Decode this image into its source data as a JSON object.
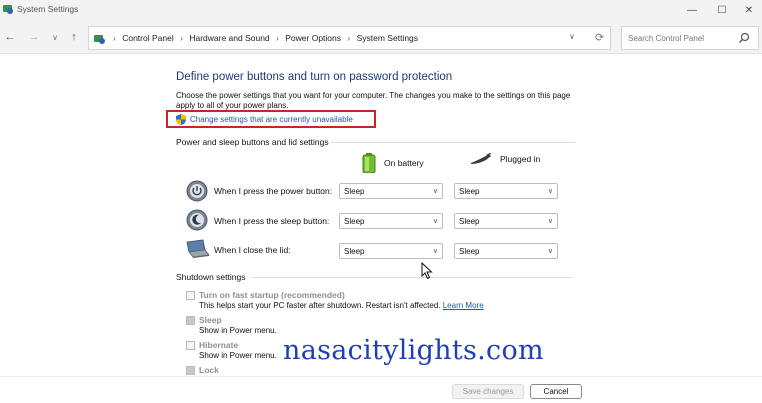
{
  "window": {
    "title": "System Settings",
    "minimize": "—",
    "maximize": "☐",
    "close": "✕"
  },
  "nav": {
    "breadcrumbs": [
      "Control Panel",
      "Hardware and Sound",
      "Power Options",
      "System Settings"
    ],
    "search_placeholder": "Search Control Panel"
  },
  "main": {
    "heading": "Define power buttons and turn on password protection",
    "description": "Choose the power settings that you want for your computer. The changes you make to the settings on this page apply to all of your power plans.",
    "change_link": "Change settings that are currently unavailable",
    "power_section": {
      "title": "Power and sleep buttons and lid settings",
      "columns": {
        "battery": "On battery",
        "plugged": "Plugged in"
      },
      "rows": [
        {
          "label": "When I press the power button:",
          "battery": "Sleep",
          "plugged": "Sleep"
        },
        {
          "label": "When I press the sleep button:",
          "battery": "Sleep",
          "plugged": "Sleep"
        },
        {
          "label": "When I close the lid:",
          "battery": "Sleep",
          "plugged": "Sleep"
        }
      ]
    },
    "shutdown_section": {
      "title": "Shutdown settings",
      "items": [
        {
          "title": "Turn on fast startup (recommended)",
          "desc": "This helps start your PC faster after shutdown. Restart isn't affected.",
          "link": "Learn More",
          "checked": false
        },
        {
          "title": "Sleep",
          "desc": "Show in Power menu.",
          "checked": true
        },
        {
          "title": "Hibernate",
          "desc": "Show in Power menu.",
          "checked": false
        },
        {
          "title": "Lock",
          "checked": true
        }
      ]
    }
  },
  "footer": {
    "save_label": "Save changes",
    "cancel_label": "Cancel"
  },
  "watermark": "nasacitylights.com",
  "colors": {
    "heading": "#1e3a78",
    "link": "#1a56b8",
    "highlight_border": "#c9242b",
    "watermark": "#1f3fb4"
  }
}
